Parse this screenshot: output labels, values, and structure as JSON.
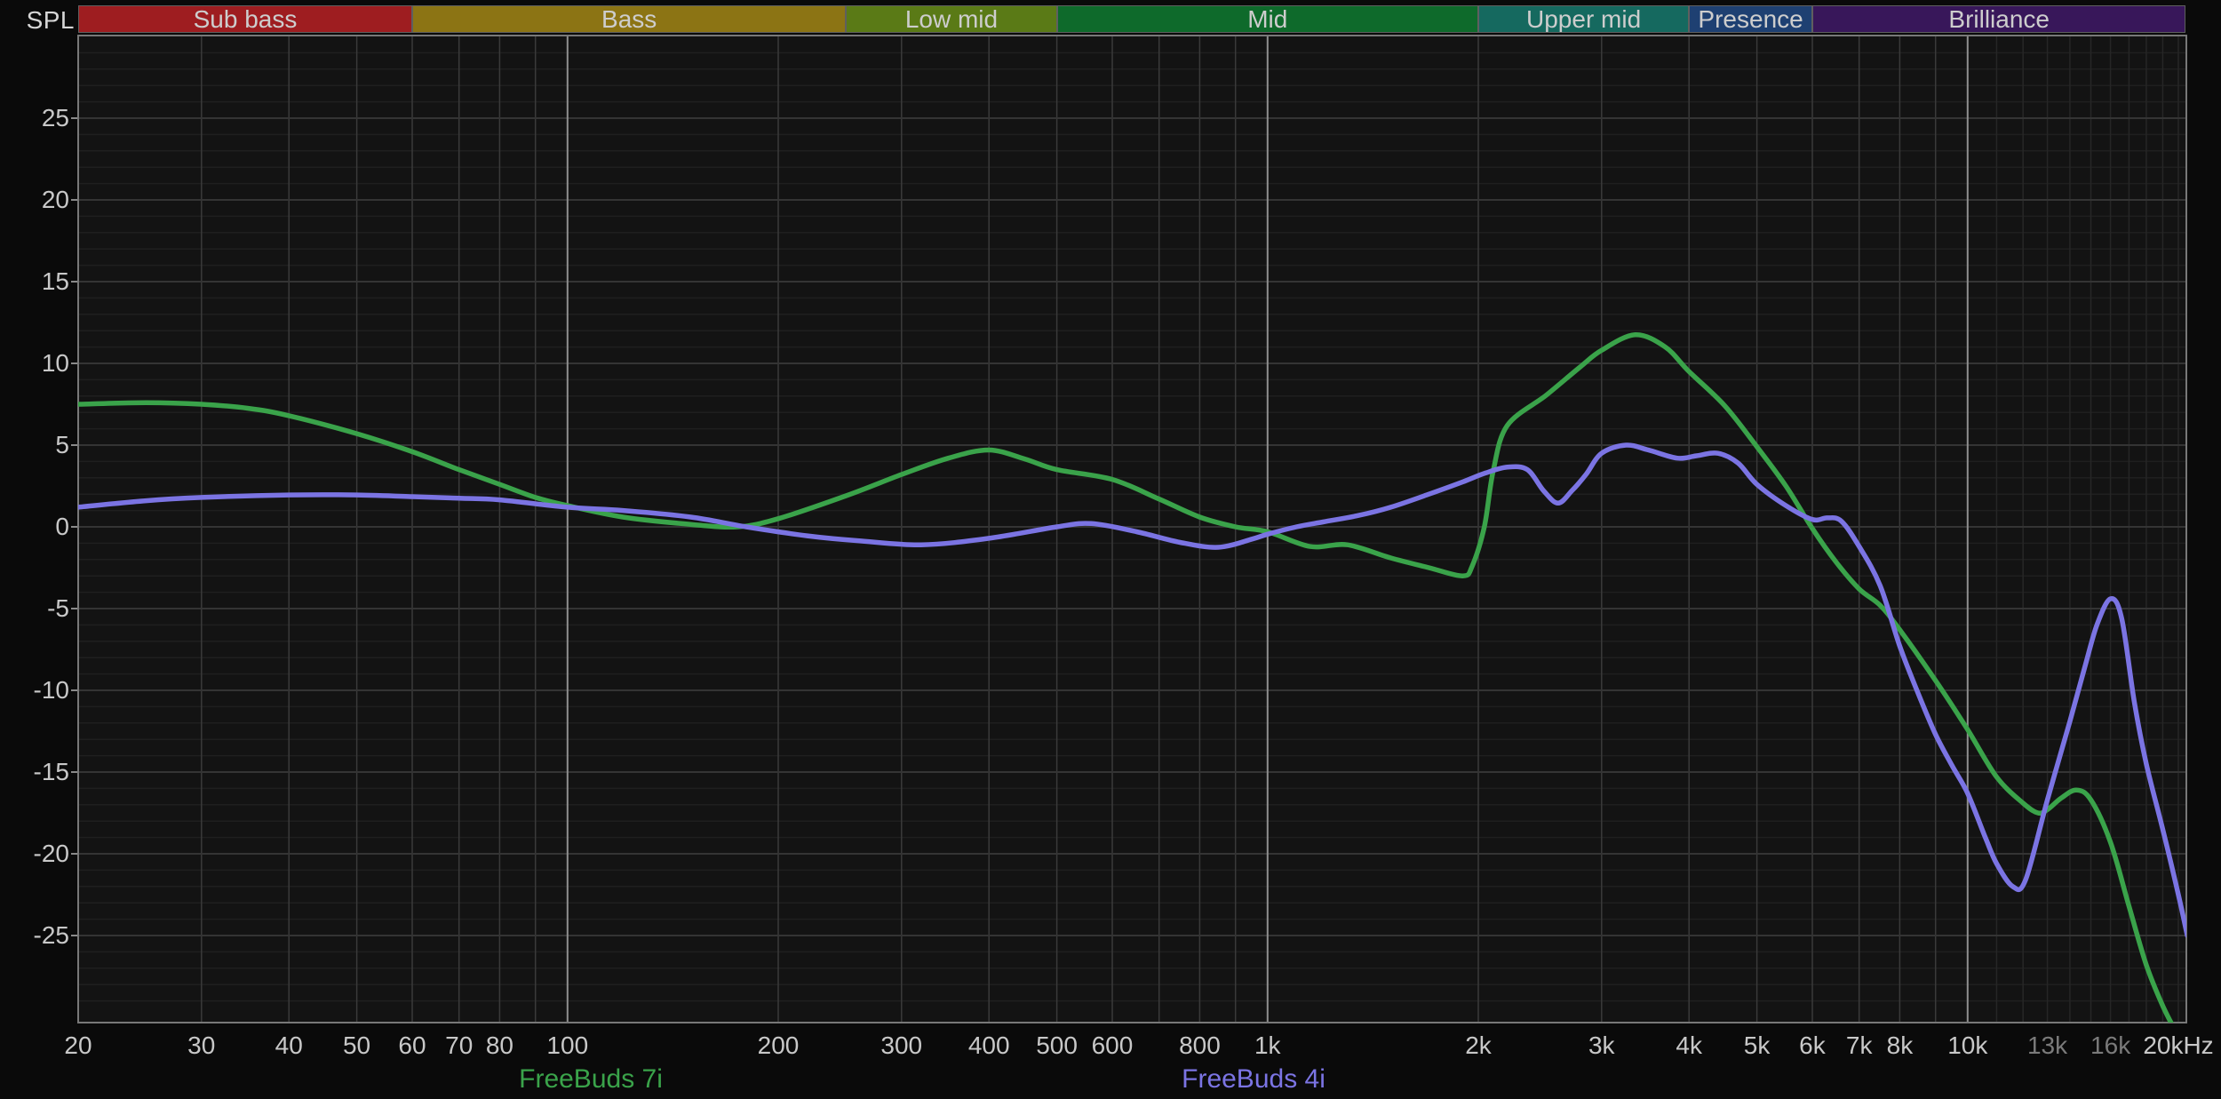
{
  "page": {
    "spl_label": "SPL"
  },
  "legend": [
    {
      "label": "FreeBuds 7i",
      "color": "#3AA34A"
    },
    {
      "label": "FreeBuds 4i",
      "color": "#7B74E3"
    }
  ],
  "chart_data": {
    "type": "line",
    "x_scale": "log",
    "ylabel": "SPL",
    "xlim": [
      20,
      20500
    ],
    "ylim": [
      -30.3,
      30.1
    ],
    "grid": "on",
    "legend_position": "bottom",
    "bands": [
      {
        "label": "Sub bass",
        "from": 20,
        "to": 60,
        "color": "#9E1D20"
      },
      {
        "label": "Bass",
        "from": 60,
        "to": 250,
        "color": "#8C7414"
      },
      {
        "label": "Low mid",
        "from": 250,
        "to": 500,
        "color": "#5A7A16"
      },
      {
        "label": "Mid",
        "from": 500,
        "to": 2000,
        "color": "#0E6A2B"
      },
      {
        "label": "Upper mid",
        "from": 2000,
        "to": 4000,
        "color": "#15695F"
      },
      {
        "label": "Presence",
        "from": 4000,
        "to": 6000,
        "color": "#1E4072"
      },
      {
        "label": "Brilliance",
        "from": 6000,
        "to": 20500,
        "color": "#38175A"
      }
    ],
    "y_ticks": [
      25,
      20,
      15,
      10,
      5,
      0,
      -5,
      -10,
      -15,
      -20,
      -25
    ],
    "x_ticks": [
      {
        "f": 20,
        "label": "20"
      },
      {
        "f": 30,
        "label": "30"
      },
      {
        "f": 40,
        "label": "40"
      },
      {
        "f": 50,
        "label": "50"
      },
      {
        "f": 60,
        "label": "60"
      },
      {
        "f": 70,
        "label": "70"
      },
      {
        "f": 80,
        "label": "80"
      },
      {
        "f": 100,
        "label": "100"
      },
      {
        "f": 200,
        "label": "200"
      },
      {
        "f": 300,
        "label": "300"
      },
      {
        "f": 400,
        "label": "400"
      },
      {
        "f": 500,
        "label": "500"
      },
      {
        "f": 600,
        "label": "600"
      },
      {
        "f": 800,
        "label": "800"
      },
      {
        "f": 1000,
        "label": "1k"
      },
      {
        "f": 2000,
        "label": "2k"
      },
      {
        "f": 3000,
        "label": "3k"
      },
      {
        "f": 4000,
        "label": "4k"
      },
      {
        "f": 5000,
        "label": "5k"
      },
      {
        "f": 6000,
        "label": "6k"
      },
      {
        "f": 7000,
        "label": "7k"
      },
      {
        "f": 8000,
        "label": "8k"
      },
      {
        "f": 10000,
        "label": "10k"
      },
      {
        "f": 13000,
        "label": "13k",
        "dim": true
      },
      {
        "f": 16000,
        "label": "16k",
        "dim": true
      },
      {
        "f": 20000,
        "label": "20kHz"
      }
    ],
    "series": [
      {
        "name": "FreeBuds 7i",
        "color": "#3AA34A",
        "points": [
          [
            20,
            7.5
          ],
          [
            25,
            7.6
          ],
          [
            30,
            7.5
          ],
          [
            35,
            7.25
          ],
          [
            40,
            6.8
          ],
          [
            50,
            5.7
          ],
          [
            60,
            4.6
          ],
          [
            70,
            3.5
          ],
          [
            80,
            2.6
          ],
          [
            90,
            1.8
          ],
          [
            100,
            1.3
          ],
          [
            120,
            0.6
          ],
          [
            150,
            0.15
          ],
          [
            175,
            0.0
          ],
          [
            200,
            0.5
          ],
          [
            250,
            1.9
          ],
          [
            300,
            3.2
          ],
          [
            350,
            4.2
          ],
          [
            400,
            4.7
          ],
          [
            450,
            4.15
          ],
          [
            500,
            3.5
          ],
          [
            600,
            2.9
          ],
          [
            700,
            1.7
          ],
          [
            800,
            0.6
          ],
          [
            900,
            0.0
          ],
          [
            1000,
            -0.3
          ],
          [
            1150,
            -1.2
          ],
          [
            1300,
            -1.1
          ],
          [
            1500,
            -1.9
          ],
          [
            1700,
            -2.5
          ],
          [
            1900,
            -3.0
          ],
          [
            1960,
            -2.4
          ],
          [
            2040,
            0.0
          ],
          [
            2100,
            3.4
          ],
          [
            2200,
            6.2
          ],
          [
            2500,
            8.05
          ],
          [
            2800,
            9.8
          ],
          [
            3000,
            10.8
          ],
          [
            3350,
            11.75
          ],
          [
            3700,
            11.0
          ],
          [
            4000,
            9.5
          ],
          [
            4500,
            7.4
          ],
          [
            5000,
            4.9
          ],
          [
            5500,
            2.5
          ],
          [
            6000,
            -0.1
          ],
          [
            6500,
            -2.2
          ],
          [
            7000,
            -3.8
          ],
          [
            7500,
            -4.8
          ],
          [
            8000,
            -6.3
          ],
          [
            9000,
            -9.4
          ],
          [
            10000,
            -12.4
          ],
          [
            11000,
            -15.3
          ],
          [
            12000,
            -16.9
          ],
          [
            12600,
            -17.5
          ],
          [
            13000,
            -17.3
          ],
          [
            13600,
            -16.6
          ],
          [
            14300,
            -16.1
          ],
          [
            15000,
            -16.7
          ],
          [
            16000,
            -19.3
          ],
          [
            17000,
            -23.2
          ],
          [
            18000,
            -26.8
          ],
          [
            19000,
            -29.3
          ],
          [
            19900,
            -31.0
          ]
        ]
      },
      {
        "name": "FreeBuds 4i",
        "color": "#7B74E3",
        "points": [
          [
            20,
            1.2
          ],
          [
            25,
            1.6
          ],
          [
            30,
            1.8
          ],
          [
            40,
            1.95
          ],
          [
            50,
            1.95
          ],
          [
            60,
            1.85
          ],
          [
            70,
            1.75
          ],
          [
            80,
            1.65
          ],
          [
            100,
            1.2
          ],
          [
            120,
            1.0
          ],
          [
            150,
            0.6
          ],
          [
            180,
            0.0
          ],
          [
            220,
            -0.55
          ],
          [
            260,
            -0.85
          ],
          [
            320,
            -1.1
          ],
          [
            400,
            -0.7
          ],
          [
            500,
            0.0
          ],
          [
            560,
            0.2
          ],
          [
            650,
            -0.3
          ],
          [
            750,
            -0.95
          ],
          [
            850,
            -1.25
          ],
          [
            950,
            -0.75
          ],
          [
            1000,
            -0.45
          ],
          [
            1100,
            0.0
          ],
          [
            1200,
            0.3
          ],
          [
            1350,
            0.7
          ],
          [
            1500,
            1.2
          ],
          [
            1700,
            2.0
          ],
          [
            1900,
            2.75
          ],
          [
            2050,
            3.3
          ],
          [
            2200,
            3.65
          ],
          [
            2350,
            3.5
          ],
          [
            2480,
            2.2
          ],
          [
            2600,
            1.45
          ],
          [
            2720,
            2.2
          ],
          [
            2850,
            3.2
          ],
          [
            3000,
            4.5
          ],
          [
            3250,
            5.0
          ],
          [
            3500,
            4.7
          ],
          [
            3850,
            4.2
          ],
          [
            4100,
            4.35
          ],
          [
            4400,
            4.5
          ],
          [
            4700,
            3.9
          ],
          [
            5000,
            2.6
          ],
          [
            5500,
            1.3
          ],
          [
            6000,
            0.45
          ],
          [
            6300,
            0.55
          ],
          [
            6600,
            0.35
          ],
          [
            7000,
            -1.2
          ],
          [
            7500,
            -3.6
          ],
          [
            8000,
            -7.3
          ],
          [
            8500,
            -10.2
          ],
          [
            9000,
            -12.7
          ],
          [
            9500,
            -14.6
          ],
          [
            10000,
            -16.3
          ],
          [
            10600,
            -19.0
          ],
          [
            11000,
            -20.6
          ],
          [
            11600,
            -22.0
          ],
          [
            12100,
            -21.6
          ],
          [
            13000,
            -16.7
          ],
          [
            14000,
            -11.9
          ],
          [
            14700,
            -8.6
          ],
          [
            15300,
            -6.0
          ],
          [
            16000,
            -4.4
          ],
          [
            16600,
            -5.6
          ],
          [
            17300,
            -10.7
          ],
          [
            18000,
            -14.5
          ],
          [
            19000,
            -18.5
          ],
          [
            20000,
            -22.5
          ],
          [
            20600,
            -25.0
          ]
        ]
      }
    ]
  }
}
